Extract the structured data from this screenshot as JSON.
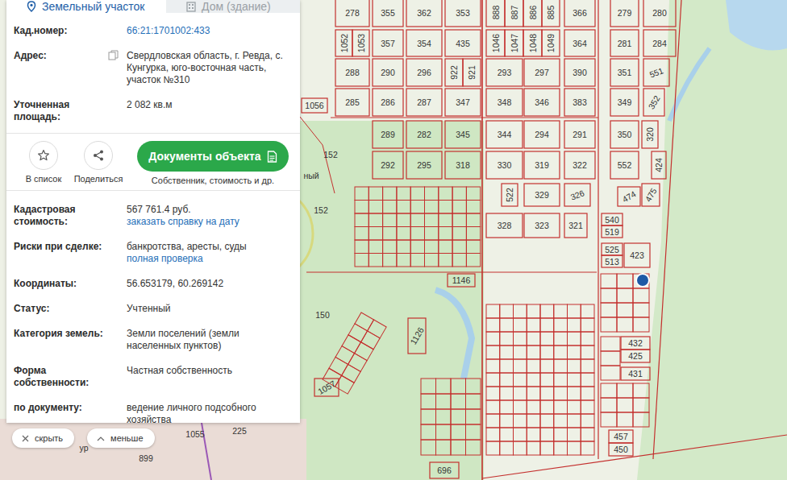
{
  "panel": {
    "tabs": [
      {
        "label": "Земельный участок",
        "selected": true
      },
      {
        "label": "Дом (здание)",
        "selected": false
      }
    ],
    "summary": [
      {
        "label": "Кад.номер:",
        "value": "66:21:1701002:433",
        "kind": "link"
      },
      {
        "label": "Адрес:",
        "value": "Свердловская область, г. Ревда, с. Кунгурка, юго-восточная часть, участок №310",
        "kind": "address"
      },
      {
        "label": "Уточненная площадь:",
        "value": "2 082 кв.м",
        "kind": "text"
      }
    ],
    "actions": {
      "buttons": [
        {
          "label": "В список"
        },
        {
          "label": "Поделиться"
        }
      ],
      "primary": {
        "label": "Документы объекта",
        "caption": "Собственник, стоимость и др."
      }
    },
    "details": [
      {
        "label": "Кадастровая стоимость:",
        "value": "567 761.4 руб.",
        "link": "заказать справку на дату"
      },
      {
        "label": "Риски при сделке:",
        "value": "банкротства, аресты, суды",
        "link": "полная проверка"
      },
      {
        "label": "Координаты:",
        "value": "56.653179, 60.269142"
      },
      {
        "label": "Статус:",
        "value": "Учтенный"
      },
      {
        "label": "Категория земель:",
        "value": "Земли поселений (земли населенных пунктов)"
      },
      {
        "label": "Форма собственности:",
        "value": "Частная собственность"
      },
      {
        "label": "по документу:",
        "value": "ведение личного подсобного хозяйства"
      }
    ]
  },
  "controls": [
    {
      "label": "скрыть"
    },
    {
      "label": "меньше"
    }
  ],
  "map": {
    "parcels": [
      {
        "label": "278"
      },
      {
        "label": "355"
      },
      {
        "label": "362"
      },
      {
        "label": "353"
      },
      {
        "label": "888"
      },
      {
        "label": "887"
      },
      {
        "label": "886"
      },
      {
        "label": "885"
      },
      {
        "label": "366"
      },
      {
        "label": "279"
      },
      {
        "label": "280"
      },
      {
        "label": "1052"
      },
      {
        "label": "1053"
      },
      {
        "label": "357"
      },
      {
        "label": "354"
      },
      {
        "label": "435"
      },
      {
        "label": "1046"
      },
      {
        "label": "1047"
      },
      {
        "label": "1048"
      },
      {
        "label": "1049"
      },
      {
        "label": "364"
      },
      {
        "label": "281"
      },
      {
        "label": "284"
      },
      {
        "label": "288"
      },
      {
        "label": "290"
      },
      {
        "label": "296"
      },
      {
        "label": "922"
      },
      {
        "label": "921"
      },
      {
        "label": "293"
      },
      {
        "label": "297"
      },
      {
        "label": "390"
      },
      {
        "label": "351"
      },
      {
        "label": "551"
      },
      {
        "label": "1056"
      },
      {
        "label": "285"
      },
      {
        "label": "286"
      },
      {
        "label": "287"
      },
      {
        "label": "347"
      },
      {
        "label": "348"
      },
      {
        "label": "346"
      },
      {
        "label": "383"
      },
      {
        "label": "349"
      },
      {
        "label": "352"
      },
      {
        "label": "289"
      },
      {
        "label": "282"
      },
      {
        "label": "345"
      },
      {
        "label": "344"
      },
      {
        "label": "294"
      },
      {
        "label": "291"
      },
      {
        "label": "350"
      },
      {
        "label": "320"
      },
      {
        "label": "292"
      },
      {
        "label": "295"
      },
      {
        "label": "318"
      },
      {
        "label": "330"
      },
      {
        "label": "319"
      },
      {
        "label": "322"
      },
      {
        "label": "552"
      },
      {
        "label": "424"
      },
      {
        "label": "522"
      },
      {
        "label": "329"
      },
      {
        "label": "326"
      },
      {
        "label": "474"
      },
      {
        "label": "475"
      },
      {
        "label": "328"
      },
      {
        "label": "323"
      },
      {
        "label": "321"
      },
      {
        "label": "540"
      },
      {
        "label": "519"
      },
      {
        "label": "525"
      },
      {
        "label": "513"
      },
      {
        "label": "423"
      },
      {
        "label": "1146"
      },
      {
        "label": "1126"
      },
      {
        "label": "1057"
      },
      {
        "label": "432"
      },
      {
        "label": "425"
      },
      {
        "label": "431"
      },
      {
        "label": "457"
      },
      {
        "label": "450"
      },
      {
        "label": "696"
      }
    ],
    "labels": [
      {
        "label": "152"
      },
      {
        "label": "152"
      },
      {
        "label": "150"
      },
      {
        "label": "1055"
      },
      {
        "label": "225"
      },
      {
        "label": "899"
      },
      {
        "label": "ный"
      },
      {
        "label": "ур"
      }
    ]
  }
}
